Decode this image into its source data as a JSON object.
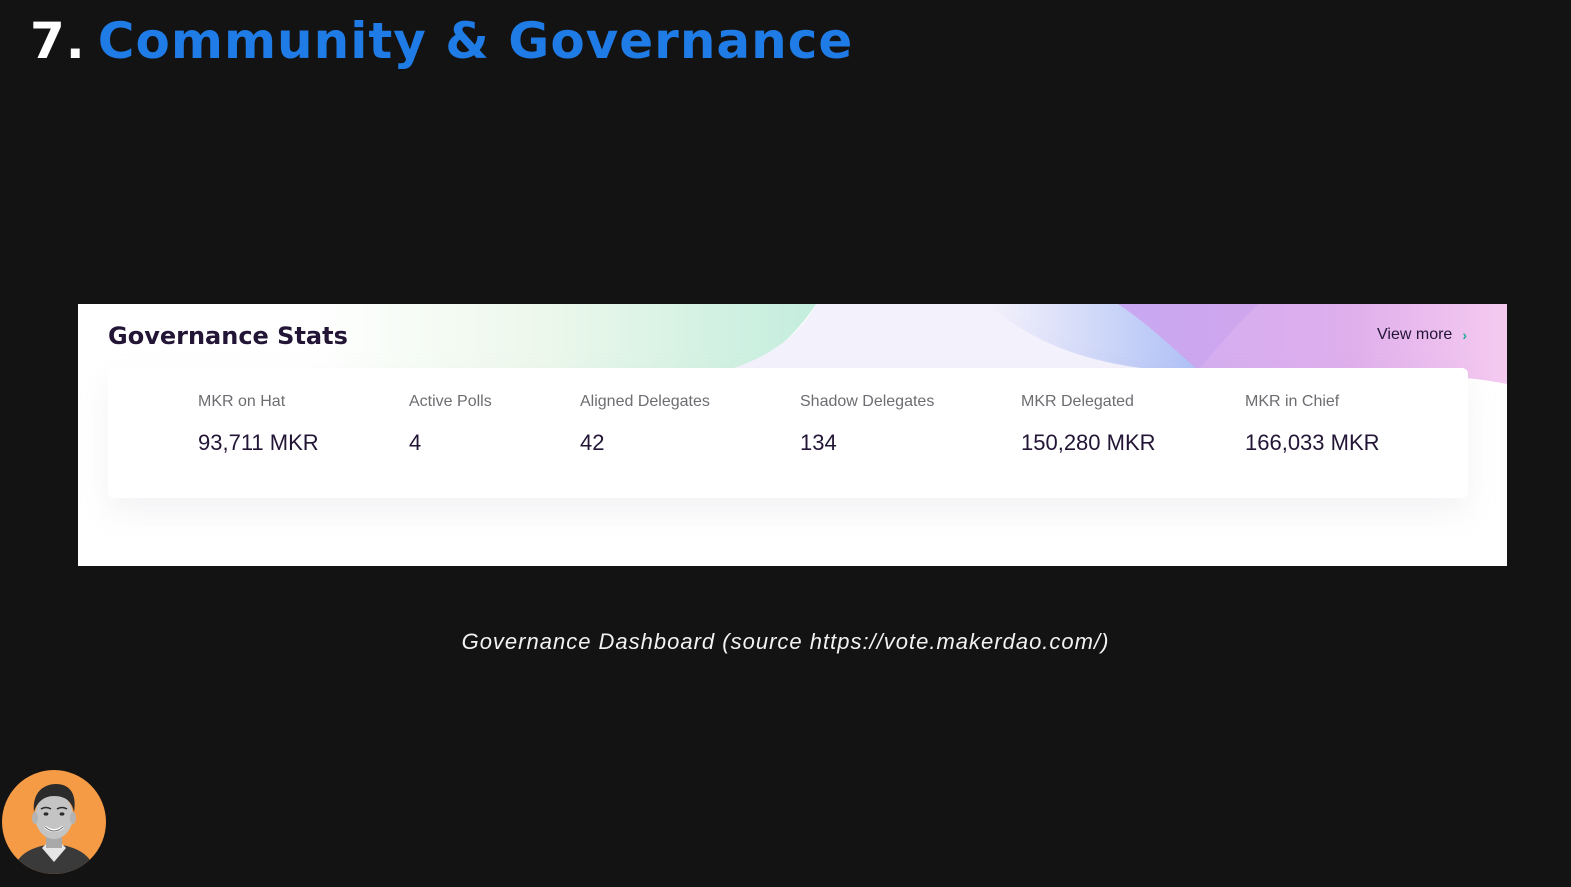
{
  "slide": {
    "number": "7.",
    "title": "Community & Governance"
  },
  "card": {
    "title": "Governance Stats",
    "view_more": "View more",
    "stats": [
      {
        "label": "MKR on Hat",
        "value": "93,711 MKR"
      },
      {
        "label": "Active Polls",
        "value": "4"
      },
      {
        "label": "Aligned Delegates",
        "value": "42"
      },
      {
        "label": "Shadow Delegates",
        "value": "134"
      },
      {
        "label": "MKR Delegated",
        "value": "150,280 MKR"
      },
      {
        "label": "MKR in Chief",
        "value": "166,033 MKR"
      }
    ]
  },
  "caption": "Governance Dashboard (source https://vote.makerdao.com/)",
  "icons": {
    "view_more": "chevron-right-icon",
    "presenter": "avatar-photo"
  },
  "colors": {
    "background": "#131313",
    "title_accent": "#1f7be6",
    "card_text": "#231536",
    "avatar_bg": "#f59a45"
  }
}
